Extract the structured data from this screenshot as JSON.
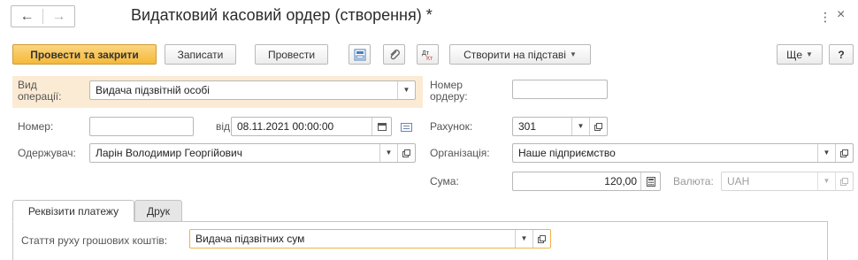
{
  "window": {
    "title": "Видатковий касовий ордер (створення) *",
    "more_glyph": "⋮",
    "close_glyph": "×"
  },
  "nav": {
    "back_glyph": "←",
    "forward_glyph": "→"
  },
  "toolbar": {
    "post_and_close": "Провести та закрити",
    "save": "Записати",
    "post": "Провести",
    "create_based_on": "Створити на підставі",
    "more": "Ще",
    "help": "?"
  },
  "form": {
    "operation_label": "Вид операції:",
    "operation_value": "Видача підзвітній особі",
    "order_number_label": "Номер ордеру:",
    "order_number_value": "",
    "number_label": "Номер:",
    "number_value": "",
    "date_label": "від:",
    "date_value": "08.11.2021 00:00:00",
    "account_label": "Рахунок:",
    "account_value": "301",
    "recipient_label": "Одержувач:",
    "recipient_value": "Ларін Володимир Георгійович",
    "organization_label": "Організація:",
    "organization_value": "Наше підприємство",
    "sum_label": "Сума:",
    "sum_value": "120,00",
    "currency_label": "Валюта:",
    "currency_value": "UAH"
  },
  "tabs": [
    {
      "label": "Реквізити платежу",
      "active": true
    },
    {
      "label": "Друк",
      "active": false
    }
  ],
  "payment": {
    "cashflow_label": "Стаття руху грошових коштів:",
    "cashflow_value": "Видача підзвітних сум"
  },
  "colors": {
    "primary_button": "#f5b938",
    "operation_band": "#fcebd4",
    "highlight_border": "#f0b24a"
  }
}
